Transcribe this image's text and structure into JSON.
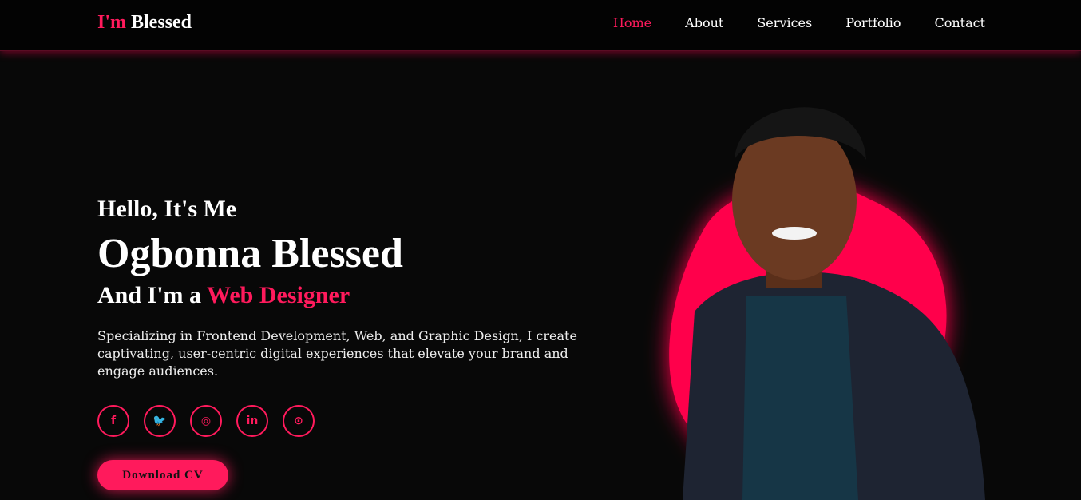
{
  "header": {
    "logo_accent": "I'm",
    "logo_rest": "Blessed",
    "nav": [
      "Home",
      "About",
      "Services",
      "Portfolio",
      "Contact"
    ],
    "active_nav": "Home"
  },
  "hero": {
    "greeting": "Hello, It's Me",
    "name": "Ogbonna Blessed",
    "role_prefix": "And I'm a",
    "role_highlight": "Web Designer",
    "description": "Specializing in Frontend Development, Web, and Graphic Design, I create captivating, user-centric digital experiences that elevate your brand and engage audiences.",
    "socials": [
      {
        "name": "facebook-icon",
        "glyph": "f"
      },
      {
        "name": "twitter-icon",
        "glyph": "🐦"
      },
      {
        "name": "instagram-icon",
        "glyph": "◎"
      },
      {
        "name": "linkedin-icon",
        "glyph": "in"
      },
      {
        "name": "github-icon",
        "glyph": "⊙"
      }
    ],
    "cv_button": "Download CV"
  },
  "colors": {
    "accent": "#ff1a5c",
    "background": "#080808",
    "text": "#ffffff"
  }
}
